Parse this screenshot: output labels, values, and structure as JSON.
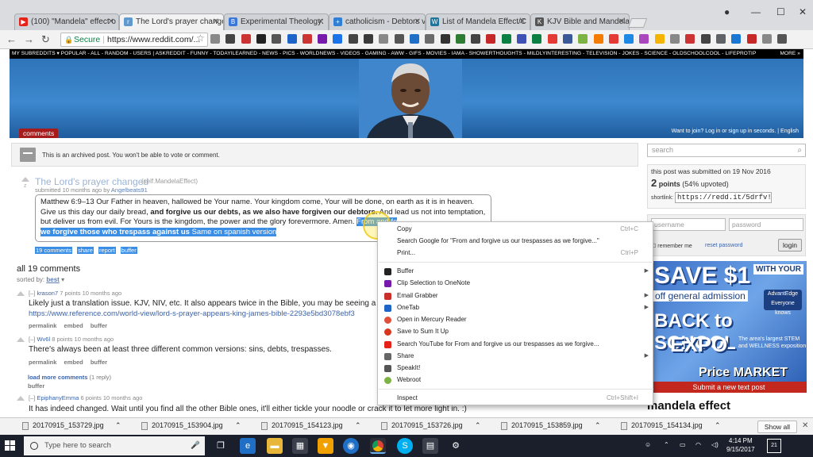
{
  "browser": {
    "tabs": [
      {
        "title": "(100) \"Mandela\" effect o",
        "favicon_color": "#e62117",
        "active": false
      },
      {
        "title": "The Lord's prayer change",
        "favicon_color": "#5f99cf",
        "active": true
      },
      {
        "title": "Experimental Theology:",
        "favicon_color": "#3b77d8",
        "active": false
      },
      {
        "title": "catholicism - Debtors vs",
        "favicon_color": "#2f7fd6",
        "active": false
      },
      {
        "title": "List of Mandela Effect/C",
        "favicon_color": "#21759b",
        "active": false
      },
      {
        "title": "KJV Bible and Mandela E",
        "favicon_color": "#555555",
        "active": false
      }
    ],
    "address": {
      "secure_label": "Secure",
      "url": "https://www.reddit.com/..."
    }
  },
  "reddit": {
    "subreddit_bar": "MY SUBREDDITS ▾   POPULAR - ALL - RANDOM - USERS | ASKREDDIT - FUNNY - TODAYILEARNED - NEWS - PICS - WORLDNEWS - VIDEOS - GAMING - AWW - GIFS - MOVIES - IAMA - SHOWERTHOUGHTS - MILDLYINTERESTING - TELEVISION - JOKES - SCIENCE - OLDSCHOOLCOOL - LIFEPROTIP",
    "more_label": "MORE »",
    "comments_tab": "comments",
    "want_join": "Want to join? Log in or sign up in seconds. | English",
    "archived_notice": "This is an archived post. You won't be able to vote or comment.",
    "post": {
      "title": "The Lord's prayer changed",
      "domain": "(self.MandelaEffect)",
      "submitted_prefix": "submitted 10 months ago by",
      "author": "Angelbeats91",
      "text_1": "Matthew 6:9–13 Our Father in heaven, hallowed be Your name. Your kingdom come, Your will be done, on earth as it is in heaven. Give us this day our daily bread,",
      "text_bold": "and forgive us our debts, as we also have forgiven our debtors.",
      "text_2": "And lead us not into temptation, but deliver us from evil. For Yours is the kingdom, the power and the glory forevermore. Amen.",
      "text_hl_1": "From and fo",
      "text_hl_bold": "we forgive those who trespass against us",
      "text_hl_2": "Same on spanish version",
      "links": [
        "19 comments",
        "share",
        "report",
        "buffer"
      ]
    },
    "all_comments": "all 19 comments",
    "sorted_label": "sorted by:",
    "sorted_value": "best",
    "comments": [
      {
        "toggle": "[–]",
        "author": "krason7",
        "meta": "7 points 10 months ago",
        "body": "Likely just a translation issue. KJV, NIV, etc. It also appears twice in the Bible, you may be seeing a fusion o",
        "link": "https://www.reference.com/world-view/lord-s-prayer-appears-king-james-bible-2293e5bd3078ebf3",
        "actions": [
          "permalink",
          "embed",
          "buffer"
        ]
      },
      {
        "toggle": "[–]",
        "author": "Wv6l",
        "meta": "8 points 10 months ago",
        "body": "There's always been at least three different common versions: sins, debts, trespasses.",
        "link": "",
        "actions": [
          "permalink",
          "embed",
          "buffer"
        ]
      },
      {
        "toggle": "[–]",
        "author": "EpiphanyEmma",
        "meta": "6 points 10 months ago",
        "body": "It has indeed changed. Wait until you find all the other Bible ones, it'll either tickle your noodle or crack it to let more light in. :)",
        "link": "",
        "actions": []
      }
    ],
    "load_more": "load more comments",
    "load_more_count": "(1 reply)",
    "buffer_label": "buffer"
  },
  "sidebar": {
    "search_placeholder": "search",
    "submitted_on": "this post was submitted on 19 Nov 2016",
    "points": "2",
    "points_label": "points",
    "upvoted": "(54% upvoted)",
    "shortlink_label": "shortlink:",
    "shortlink": "https://redd.it/5drfv!",
    "username_placeholder": "username",
    "password_placeholder": "password",
    "remember_me": "remember me",
    "reset_password": "reset password",
    "login": "login",
    "ad": {
      "line1": "SAVE $1",
      "with_your": "WITH YOUR",
      "line2": "off general admission",
      "logo": "AdvantEdge Everyone knows",
      "line3": "BACK to SCHOOL",
      "line4": "EXPO",
      "line5": "The area's largest STEM and WELLNESS exposition",
      "line6": "Price MARKET"
    },
    "submit_text": "Submit a new text post",
    "title": "mandela effect"
  },
  "context_menu": {
    "items": [
      {
        "label": "Copy",
        "shortcut": "Ctrl+C"
      },
      {
        "label": "Search Google for \"From and forgive us our trespasses as we forgive...\"",
        "shortcut": ""
      },
      {
        "label": "Print...",
        "shortcut": "Ctrl+P"
      },
      {
        "label": "Buffer",
        "submenu": true,
        "icon_color": "#222222"
      },
      {
        "label": "Clip Selection to OneNote",
        "icon_color": "#7719aa"
      },
      {
        "label": "Email Grabber",
        "submenu": true,
        "icon_color": "#c9302c"
      },
      {
        "label": "OneTab",
        "submenu": true,
        "icon_color": "#1e64c8"
      },
      {
        "label": "Open in Mercury Reader",
        "icon_color": "#e14e3a"
      },
      {
        "label": "Save to Sum It Up",
        "icon_color": "#d9361e"
      },
      {
        "label": "Search YouTube for From and forgive us our trespasses as we forgive...",
        "icon_color": "#e62117"
      },
      {
        "label": "Share",
        "submenu": true,
        "icon_color": "#666666"
      },
      {
        "label": "SpeakIt!",
        "icon_color": "#555555"
      },
      {
        "label": "Webroot",
        "icon_color": "#7cb342"
      },
      {
        "label": "Inspect",
        "shortcut": "Ctrl+Shift+I"
      }
    ]
  },
  "downloads": {
    "files": [
      "20170915_153729.jpg",
      "20170915_153904.jpg",
      "20170915_154123.jpg",
      "20170915_153726.jpg",
      "20170915_153859.jpg",
      "20170915_154134.jpg"
    ],
    "show_all": "Show all"
  },
  "taskbar": {
    "search_placeholder": "Type here to search",
    "time": "4:14 PM",
    "date": "9/15/2017",
    "notifications": "21"
  }
}
